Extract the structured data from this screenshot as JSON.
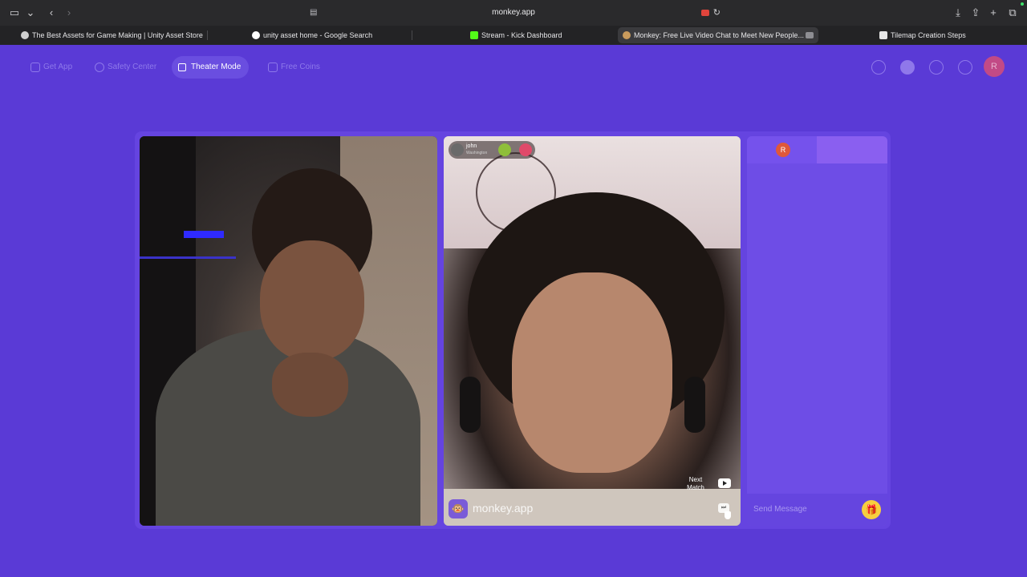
{
  "browser": {
    "url": "monkey.app",
    "tabs": [
      {
        "title": "The Best Assets for Game Making | Unity Asset Store",
        "active": false
      },
      {
        "title": "unity asset home - Google Search",
        "active": false
      },
      {
        "title": "Stream - Kick Dashboard",
        "active": false
      },
      {
        "title": "Monkey: Free Live Video Chat to Meet New People...",
        "active": true
      },
      {
        "title": "Tilemap Creation Steps",
        "active": false
      }
    ]
  },
  "nav": {
    "items": [
      {
        "label": "Get App",
        "icon": "phone-icon"
      },
      {
        "label": "Safety Center",
        "icon": "shield-icon"
      },
      {
        "label": "Theater Mode",
        "icon": "expand-icon"
      },
      {
        "label": "Free Coins",
        "icon": "coins-icon"
      }
    ],
    "profile_initial": "R"
  },
  "match": {
    "username": "john",
    "location": "Washington",
    "next_match_label": "Next Match",
    "brand_text": "monkey.app"
  },
  "chat": {
    "self_initial": "R",
    "placeholder": "Send Message"
  },
  "colors": {
    "page_bg": "#5a3ad6",
    "panel_bg": "#6e4de6",
    "accent_yellow": "#f7cf3f"
  }
}
